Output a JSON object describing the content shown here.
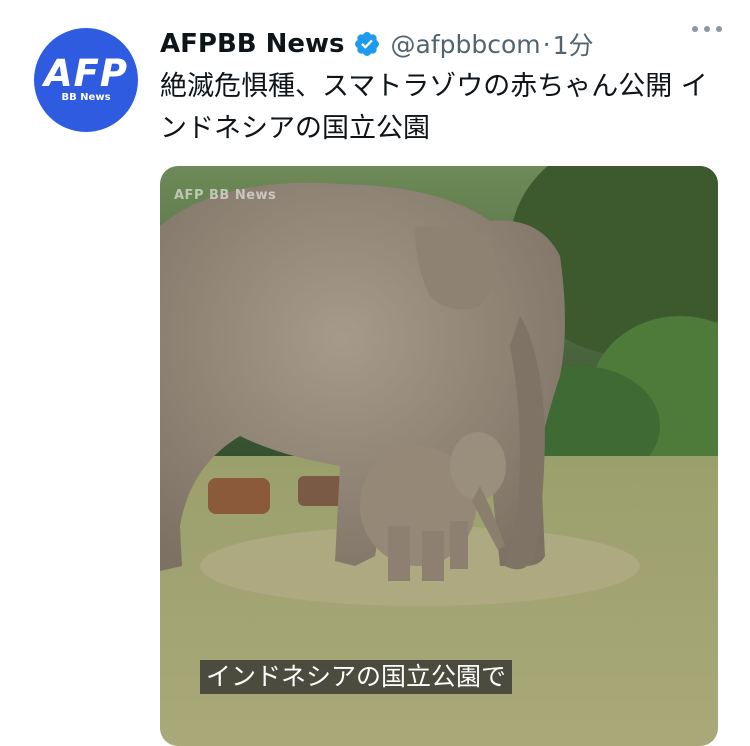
{
  "account": {
    "avatar_text": "AFP",
    "avatar_subtext": "BB News",
    "display_name": "AFPBB News",
    "handle": "@afpbbcom",
    "separator": "·",
    "time": "1分",
    "verified_icon": "verified-badge-icon"
  },
  "tweet": {
    "text": "絶滅危惧種、スマトラゾウの赤ちゃん公開 インドネシアの国立公園"
  },
  "media": {
    "watermark": "AFP BB News",
    "subtitle": "インドネシアの国立公園で"
  },
  "colors": {
    "brand": "#2f5be0",
    "verified": "#1d9bf0",
    "text_primary": "#0f1419",
    "text_secondary": "#536471"
  }
}
